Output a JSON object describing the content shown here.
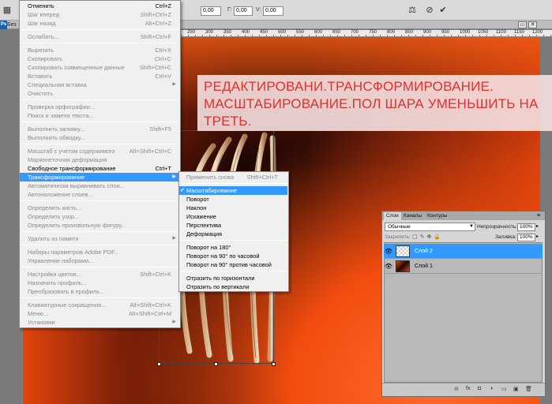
{
  "options_bar": {
    "field1": "0,00",
    "angle_label": "Г:",
    "field2": "0,00",
    "v_label": "V:",
    "field3": "0,00",
    "cancel_icon": "cancel-icon",
    "commit_icon": "check-icon"
  },
  "document": {
    "app_badge": "Ps",
    "tab_label": "Без"
  },
  "ruler": {
    "ticks": [
      "250",
      "300",
      "350",
      "400",
      "450",
      "500",
      "550",
      "600",
      "650",
      "700",
      "750",
      "800",
      "850",
      "900",
      "950",
      "1000",
      "1050",
      "1100",
      "1150",
      "1200"
    ]
  },
  "annotation": {
    "text": "РЕДАКТИРОВАНИ.ТРАНСФОРМИРОВАНИЕ. МАСШТАБИРОВАНИЕ.ПОЛ ШАРА УМЕНЬШИТЬ НА ТРЕТЬ."
  },
  "edit_menu": {
    "items": [
      {
        "label": "Отменить",
        "shortcut": "Ctrl+Z",
        "state": "enabled"
      },
      {
        "label": "Шаг вперед",
        "shortcut": "Shift+Ctrl+Z",
        "state": "disabled"
      },
      {
        "label": "Шаг назад",
        "shortcut": "Alt+Ctrl+Z",
        "state": "disabled"
      },
      {
        "label": "Ослабить...",
        "shortcut": "Shift+Ctrl+F",
        "state": "disabled"
      },
      {
        "label": "Вырезать",
        "shortcut": "Ctrl+X",
        "state": "disabled"
      },
      {
        "label": "Скопировать",
        "shortcut": "Ctrl+C",
        "state": "disabled"
      },
      {
        "label": "Скопировать совмещенные данные",
        "shortcut": "Shift+Ctrl+C",
        "state": "disabled"
      },
      {
        "label": "Вставить",
        "shortcut": "Ctrl+V",
        "state": "disabled"
      },
      {
        "label": "Специальная вставка",
        "shortcut": "",
        "state": "disabled",
        "submenu": true
      },
      {
        "label": "Очистить",
        "shortcut": "",
        "state": "disabled"
      },
      {
        "label": "Проверка орфографии...",
        "shortcut": "",
        "state": "disabled"
      },
      {
        "label": "Поиск и замена текста...",
        "shortcut": "",
        "state": "disabled"
      },
      {
        "label": "Выполнить заливку...",
        "shortcut": "Shift+F5",
        "state": "disabled"
      },
      {
        "label": "Выполнить обводку...",
        "shortcut": "",
        "state": "disabled"
      },
      {
        "label": "Масштаб с учетом содержимого",
        "shortcut": "Alt+Shift+Ctrl+C",
        "state": "disabled"
      },
      {
        "label": "Марионеточная деформация",
        "shortcut": "",
        "state": "disabled"
      },
      {
        "label": "Свободное трансформирование",
        "shortcut": "Ctrl+T",
        "state": "enabled"
      },
      {
        "label": "Трансформирование",
        "shortcut": "",
        "state": "selected",
        "submenu": true
      },
      {
        "label": "Автоматически выравнивать слои...",
        "shortcut": "",
        "state": "disabled"
      },
      {
        "label": "Автоналожение слоев...",
        "shortcut": "",
        "state": "disabled"
      },
      {
        "label": "Определить кисть...",
        "shortcut": "",
        "state": "disabled"
      },
      {
        "label": "Определить узор...",
        "shortcut": "",
        "state": "disabled"
      },
      {
        "label": "Определить произвольную фигуру...",
        "shortcut": "",
        "state": "disabled"
      },
      {
        "label": "Удалить из памяти",
        "shortcut": "",
        "state": "disabled",
        "submenu": true
      },
      {
        "label": "Наборы параметров Adobe PDF...",
        "shortcut": "",
        "state": "disabled"
      },
      {
        "label": "Управление наборами...",
        "shortcut": "",
        "state": "disabled"
      },
      {
        "label": "Настройка цветов...",
        "shortcut": "Shift+Ctrl+K",
        "state": "disabled"
      },
      {
        "label": "Назначить профиль...",
        "shortcut": "",
        "state": "disabled"
      },
      {
        "label": "Преобразовать в профиль...",
        "shortcut": "",
        "state": "disabled"
      },
      {
        "label": "Клавиатурные сокращения...",
        "shortcut": "Alt+Shift+Ctrl+K",
        "state": "disabled"
      },
      {
        "label": "Меню...",
        "shortcut": "Alt+Shift+Ctrl+M",
        "state": "disabled"
      },
      {
        "label": "Установки",
        "shortcut": "",
        "state": "disabled",
        "submenu": true
      }
    ]
  },
  "transform_submenu": {
    "items": [
      {
        "label": "Применить снова",
        "shortcut": "Shift+Ctrl+T",
        "state": "disabled"
      },
      {
        "label": "Масштабирование",
        "shortcut": "",
        "state": "selected",
        "checked": true
      },
      {
        "label": "Поворот",
        "shortcut": "",
        "state": "enabled"
      },
      {
        "label": "Наклон",
        "shortcut": "",
        "state": "enabled"
      },
      {
        "label": "Искажение",
        "shortcut": "",
        "state": "enabled"
      },
      {
        "label": "Перспектива",
        "shortcut": "",
        "state": "enabled"
      },
      {
        "label": "Деформация",
        "shortcut": "",
        "state": "enabled"
      },
      {
        "label": "Поворот на 180°",
        "shortcut": "",
        "state": "enabled"
      },
      {
        "label": "Поворот на 90° по часовой",
        "shortcut": "",
        "state": "enabled"
      },
      {
        "label": "Поворот на 90° против часовой",
        "shortcut": "",
        "state": "enabled"
      },
      {
        "label": "Отразить по горизонтали",
        "shortcut": "",
        "state": "enabled"
      },
      {
        "label": "Отразить по вертикали",
        "shortcut": "",
        "state": "enabled"
      }
    ],
    "check_mark": "✔"
  },
  "layers_panel": {
    "tabs": [
      "Слои",
      "Каналы",
      "Контуры"
    ],
    "active_tab": "Слои",
    "blend_mode": "Обычные",
    "opacity_label": "Непрозрачность:",
    "opacity_value": "100%",
    "lock_label": "Закрепить:",
    "fill_label": "Заливка:",
    "fill_value": "100%",
    "layers": [
      {
        "name": "Слой 2",
        "selected": true
      },
      {
        "name": "Слой 1",
        "selected": false
      }
    ],
    "footer_icons": [
      "link-icon",
      "fx-icon",
      "mask-icon",
      "adjustment-icon",
      "group-icon",
      "new-layer-icon",
      "trash-icon"
    ],
    "footer_glyphs": [
      "⊝",
      "fx",
      "◘",
      "◑",
      "▭",
      "▣",
      "🗑"
    ]
  },
  "colors": {
    "menu_highlight": "#3399ff",
    "annotation_text": "#e03030",
    "canvas_orange": "#e2450c"
  }
}
